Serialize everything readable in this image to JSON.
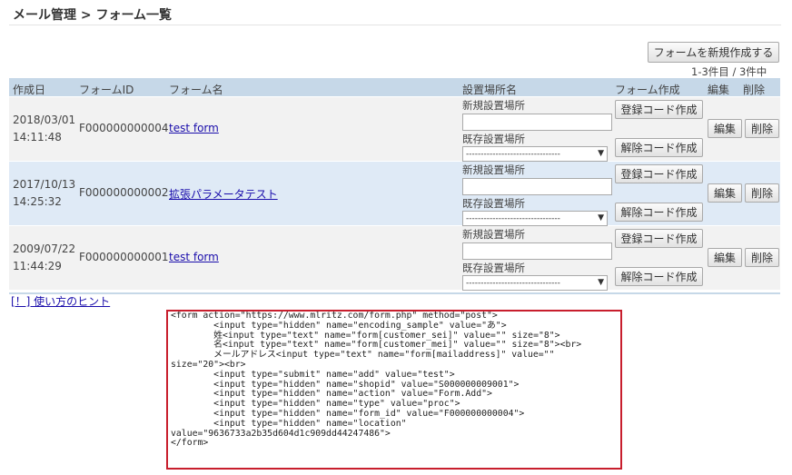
{
  "page": {
    "title": "メール管理 > フォーム一覧",
    "create_button": "フォームを新規作成する",
    "count_text": "1-3件目 / 3件中"
  },
  "table": {
    "headers": {
      "created": "作成日",
      "form_id": "フォームID",
      "form_name": "フォーム名",
      "location": "設置場所名",
      "form_create": "フォーム作成",
      "edit": "編集",
      "delete": "削除"
    },
    "rows": [
      {
        "date": "2018/03/01",
        "time": "14:11:48",
        "form_id": "F000000000004",
        "form_name": "test form",
        "new_loc_label": "新規設置場所",
        "existing_loc_label": "既存設置場所",
        "existing_loc_value": "--------------------------------",
        "reg_button": "登録コード作成",
        "unreg_button": "解除コード作成",
        "edit_button": "編集",
        "delete_button": "削除"
      },
      {
        "date": "2017/10/13",
        "time": "14:25:32",
        "form_id": "F000000000002",
        "form_name": "拡張パラメータテスト",
        "new_loc_label": "新規設置場所",
        "existing_loc_label": "既存設置場所",
        "existing_loc_value": "--------------------------------",
        "reg_button": "登録コード作成",
        "unreg_button": "解除コード作成",
        "edit_button": "編集",
        "delete_button": "削除"
      },
      {
        "date": "2009/07/22",
        "time": "11:44:29",
        "form_id": "F000000000001",
        "form_name": "test form",
        "new_loc_label": "新規設置場所",
        "existing_loc_label": "既存設置場所",
        "existing_loc_value": "--------------------------------",
        "reg_button": "登録コード作成",
        "unreg_button": "解除コード作成",
        "edit_button": "編集",
        "delete_button": "削除"
      }
    ]
  },
  "hint_link": "[！] 使い方のヒント",
  "code_snippet": "<form action=\"https://www.mlritz.com/form.php\" method=\"post\">\n        <input type=\"hidden\" name=\"encoding_sample\" value=\"あ\">\n        姓<input type=\"text\" name=\"form[customer_sei]\" value=\"\" size=\"8\">\n        名<input type=\"text\" name=\"form[customer_mei]\" value=\"\" size=\"8\"><br>\n        メールアドレス<input type=\"text\" name=\"form[mailaddress]\" value=\"\"\nsize=\"20\"><br>\n        <input type=\"submit\" name=\"add\" value=\"test\">\n        <input type=\"hidden\" name=\"shopid\" value=\"S000000009001\">\n        <input type=\"hidden\" name=\"action\" value=\"Form.Add\">\n        <input type=\"hidden\" name=\"type\" value=\"proc\">\n        <input type=\"hidden\" name=\"form_id\" value=\"F000000000004\">\n        <input type=\"hidden\" name=\"location\"\nvalue=\"9636733a2b35d604d1c909dd44247486\">\n</form>"
}
